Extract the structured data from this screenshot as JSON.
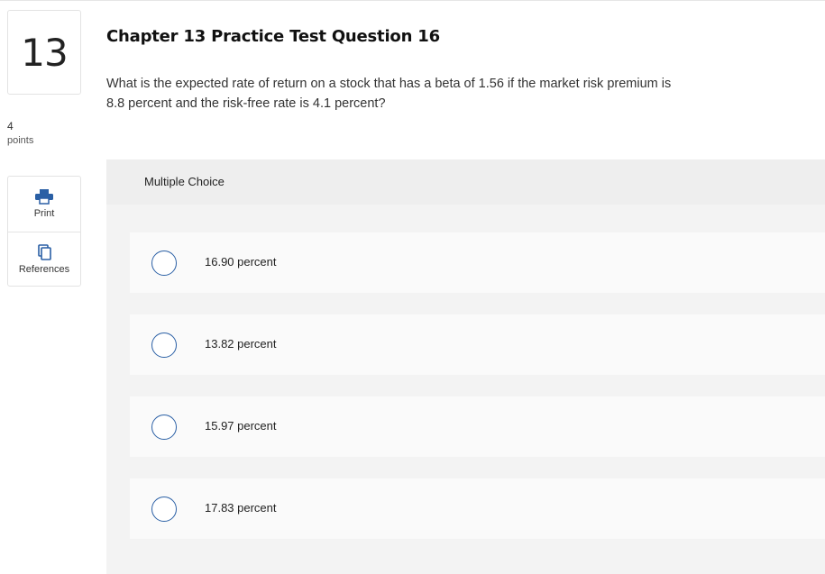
{
  "question": {
    "number": "13",
    "points_value": "4",
    "points_label": "points",
    "title": "Chapter 13 Practice Test Question 16",
    "text": "What is the expected rate of return on a stock that has a beta of 1.56 if the market risk premium is 8.8 percent and the risk-free rate is 4.1 percent?"
  },
  "tools": {
    "print_label": "Print",
    "print_icon": "printer-icon",
    "references_label": "References",
    "references_icon": "references-icon"
  },
  "multiple_choice": {
    "label": "Multiple Choice",
    "choices": [
      {
        "label": "16.90 percent"
      },
      {
        "label": "13.82 percent"
      },
      {
        "label": "15.97 percent"
      },
      {
        "label": "17.83 percent"
      }
    ]
  },
  "colors": {
    "accent": "#2a5fa5",
    "panel_bg": "#f0f0f0"
  }
}
